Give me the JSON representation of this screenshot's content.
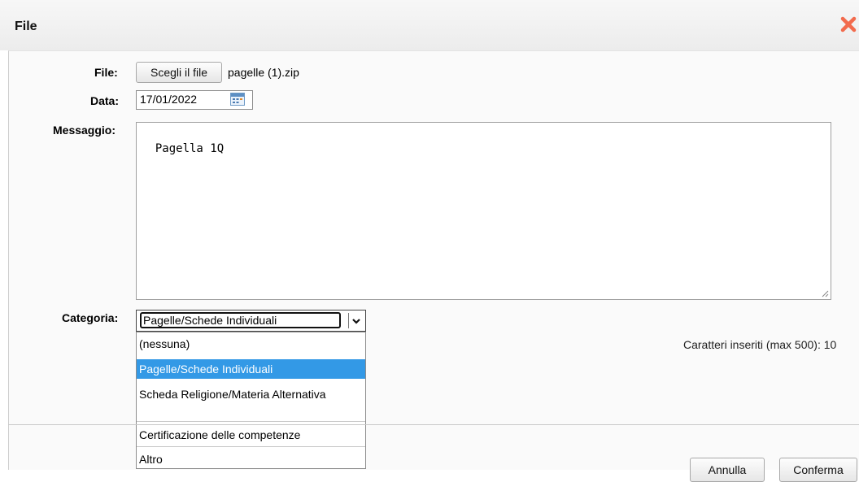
{
  "dialog": {
    "title": "File"
  },
  "form": {
    "file_label": "File:",
    "choose_file_button": "Scegli il file",
    "file_name": "pagelle (1).zip",
    "date_label": "Data:",
    "date_value": "17/01/2022",
    "message_label": "Messaggio:",
    "message_value": "Pagella 1Q",
    "category_label": "Categoria:",
    "category_selected": "Pagelle/Schede Individuali",
    "category_options": [
      {
        "label": "(nessuna)",
        "selected": false
      },
      {
        "label": "Pagelle/Schede Individuali",
        "selected": true
      },
      {
        "label": "Scheda Religione/Materia Alternativa",
        "selected": false
      },
      {
        "label": "Certificazione delle competenze",
        "selected": false
      },
      {
        "label": "Altro",
        "selected": false
      }
    ],
    "char_counter": "Caratteri inseriti (max 500): 10"
  },
  "footer": {
    "cancel_button": "Annulla",
    "confirm_button": "Conferma"
  },
  "colors": {
    "close_icon": "#f26b4d",
    "selected_option_bg": "#3399e6"
  },
  "icons": [
    "close-icon",
    "calendar-icon",
    "chevron-down-icon",
    "resize-grip-icon"
  ]
}
